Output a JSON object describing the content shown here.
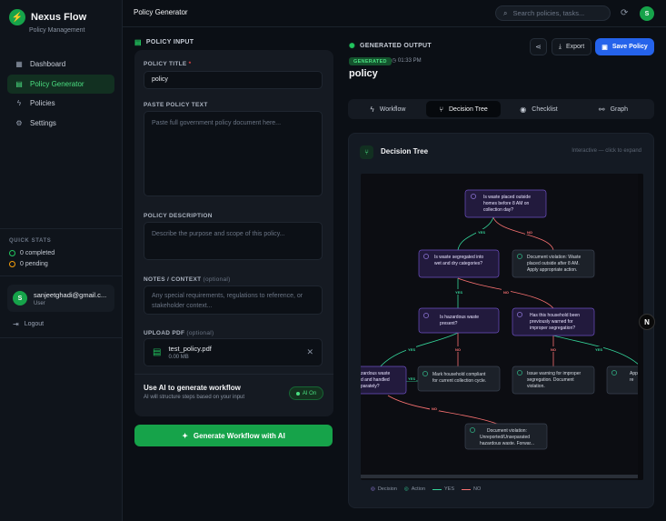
{
  "app": {
    "name": "Nexus Flow",
    "subtitle": "Policy Management"
  },
  "sidebar": {
    "items": [
      {
        "label": "Dashboard",
        "icon": "grid-icon"
      },
      {
        "label": "Policy Generator",
        "icon": "document-icon",
        "active": true
      },
      {
        "label": "Policies",
        "icon": "bolt-icon"
      },
      {
        "label": "Settings",
        "icon": "gear-icon"
      }
    ],
    "quick_stats_title": "QUICK STATS",
    "completed": "0 completed",
    "pending": "0 pending",
    "user": {
      "initial": "S",
      "email": "sanjeetghadi@gmail.c...",
      "role": "User"
    },
    "logout": "Logout"
  },
  "header": {
    "title": "Policy Generator",
    "search_placeholder": "Search policies, tasks...",
    "avatar_initial": "S"
  },
  "input": {
    "section_title": "POLICY INPUT",
    "title_label": "POLICY TITLE",
    "title_required": "*",
    "title_value": "policy",
    "paste_label": "PASTE POLICY TEXT",
    "paste_placeholder": "Paste full government policy document here...",
    "desc_label": "POLICY DESCRIPTION",
    "desc_placeholder": "Describe the purpose and scope of this policy...",
    "notes_label": "NOTES / CONTEXT",
    "notes_optional": "(optional)",
    "notes_placeholder": "Any special requirements, regulations to reference, or stakeholder context...",
    "upload_label": "UPLOAD PDF",
    "upload_optional": "(optional)",
    "file_name": "test_policy.pdf",
    "file_size": "0.00 MB",
    "ai_title": "Use AI to generate workflow",
    "ai_sub": "AI will structure steps based on your input",
    "ai_toggle": "AI On",
    "generate_button": "Generate Workflow with AI"
  },
  "output": {
    "section_title": "GENERATED OUTPUT",
    "badge": "GENERATED",
    "time": "01:33 PM",
    "title": "policy",
    "export": "Export",
    "save": "Save Policy",
    "tabs": [
      "Workflow",
      "Decision Tree",
      "Checklist",
      "Graph"
    ],
    "active_tab": "Decision Tree",
    "tree_title": "Decision Tree",
    "tree_hint": "Interactive — click to expand",
    "nodes": {
      "root": [
        "Is waste placed outside",
        "homes before 8 AM on",
        "collection day?"
      ],
      "violation1": [
        "Document violation: Waste",
        "placed outside after 8 AM.",
        "Apply appropriate action."
      ],
      "segregated": [
        "Is waste segregated into",
        "wet and dry categories?"
      ],
      "hazardous": [
        "Is hazardous waste",
        "present?"
      ],
      "warned": [
        "Has this household been",
        "previously warned for",
        "improper segregation?"
      ],
      "handled": [
        "zardous waste",
        "d and handled",
        "parately?"
      ],
      "compliant": [
        "Mark household compliant",
        "for current collection cycle."
      ],
      "warning": [
        "Issue warning for improper",
        "segregation. Document",
        "violation."
      ],
      "appl": [
        "App",
        "re"
      ],
      "violation2": [
        "Document violation:",
        "Unreported/Unseparated",
        "hazardous waste. Forwar..."
      ]
    },
    "edge_labels": {
      "yes": "YES",
      "no": "NO"
    },
    "legend": {
      "decision": "Decision",
      "action": "Action",
      "yes": "YES",
      "no": "NO"
    },
    "colors": {
      "yes": "#34d399",
      "no": "#f87171",
      "decision": "#a78bfa",
      "action": "#34d399"
    }
  },
  "floating_badge": "N"
}
